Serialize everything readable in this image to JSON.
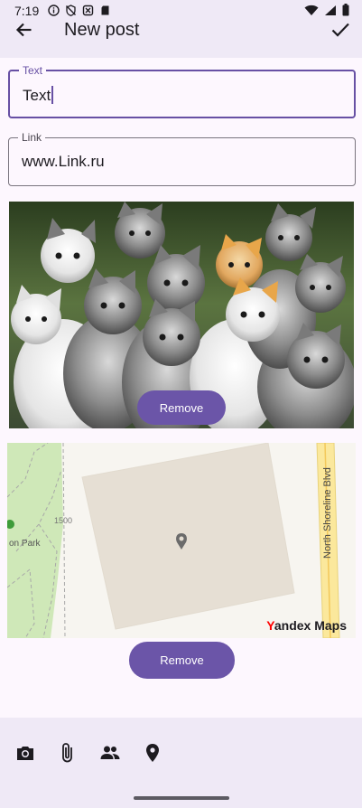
{
  "status_bar": {
    "time": "7:19"
  },
  "app_bar": {
    "title": "New post"
  },
  "form": {
    "text_field": {
      "label": "Text",
      "value": "Text"
    },
    "link_field": {
      "label": "Link",
      "value": "www.Link.ru"
    }
  },
  "attachment": {
    "remove_label": "Remove"
  },
  "map": {
    "remove_label": "Remove",
    "street_label": "North Shoreline Blvd",
    "park_label": "on Park",
    "number_label": "1500",
    "logo_y": "Y",
    "logo_rest": "andex Maps"
  },
  "bottom_bar": {
    "icons": [
      "camera-icon",
      "attach-icon",
      "people-icon",
      "location-icon"
    ]
  },
  "colors": {
    "accent": "#6750a4",
    "button": "#6b55a8",
    "surface": "#efe9f6",
    "background": "#fdf7fe"
  }
}
